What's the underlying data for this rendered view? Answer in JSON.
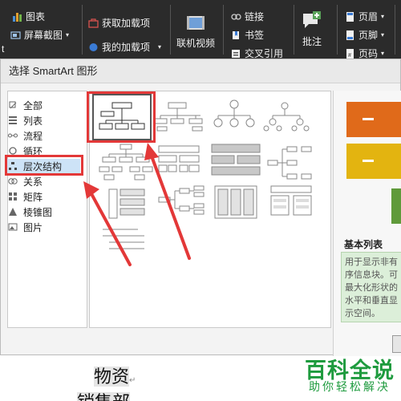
{
  "ribbon": {
    "chart_label": "图表",
    "screenshot_label": "屏幕截图",
    "get_addins_label": "获取加载项",
    "my_addins_label": "我的加载项",
    "online_video_label": "联机视频",
    "link_label": "链接",
    "bookmark_label": "书签",
    "crossref_label": "交叉引用",
    "comment_label": "批注",
    "header_label": "页眉",
    "footer_label": "页脚",
    "pagenum_label": "页码",
    "partial_left_label": "t"
  },
  "dialog": {
    "title": "选择 SmartArt 图形",
    "categories": [
      {
        "label": "全部",
        "icon": "all-icon"
      },
      {
        "label": "列表",
        "icon": "list-icon"
      },
      {
        "label": "流程",
        "icon": "process-icon"
      },
      {
        "label": "循环",
        "icon": "cycle-icon"
      },
      {
        "label": "层次结构",
        "icon": "hierarchy-icon"
      },
      {
        "label": "关系",
        "icon": "relationship-icon"
      },
      {
        "label": "矩阵",
        "icon": "matrix-icon"
      },
      {
        "label": "棱锥图",
        "icon": "pyramid-icon"
      },
      {
        "label": "图片",
        "icon": "picture-icon"
      }
    ],
    "selected_category": "层次结构",
    "preview_title": "基本列表",
    "preview_desc": "用于显示非有序信息块。可最大化形状的水平和垂直显示空间。",
    "preview_desc_visible": "用于显示非有序信\n块。可最大化形\n间。"
  },
  "document": {
    "line1": "物资",
    "line2": "销售部"
  },
  "watermark": {
    "brand": "百科全说",
    "slogan": "助你轻松解决"
  },
  "colors": {
    "ribbon_bg": "#2b2b2b",
    "highlight_red": "#e33838",
    "selection_blue": "#cde3f7",
    "preview_orange": "#e06a1a",
    "preview_yellow": "#e3b410",
    "preview_green": "#5f9a3a",
    "brand_green": "#1e9b3e"
  }
}
